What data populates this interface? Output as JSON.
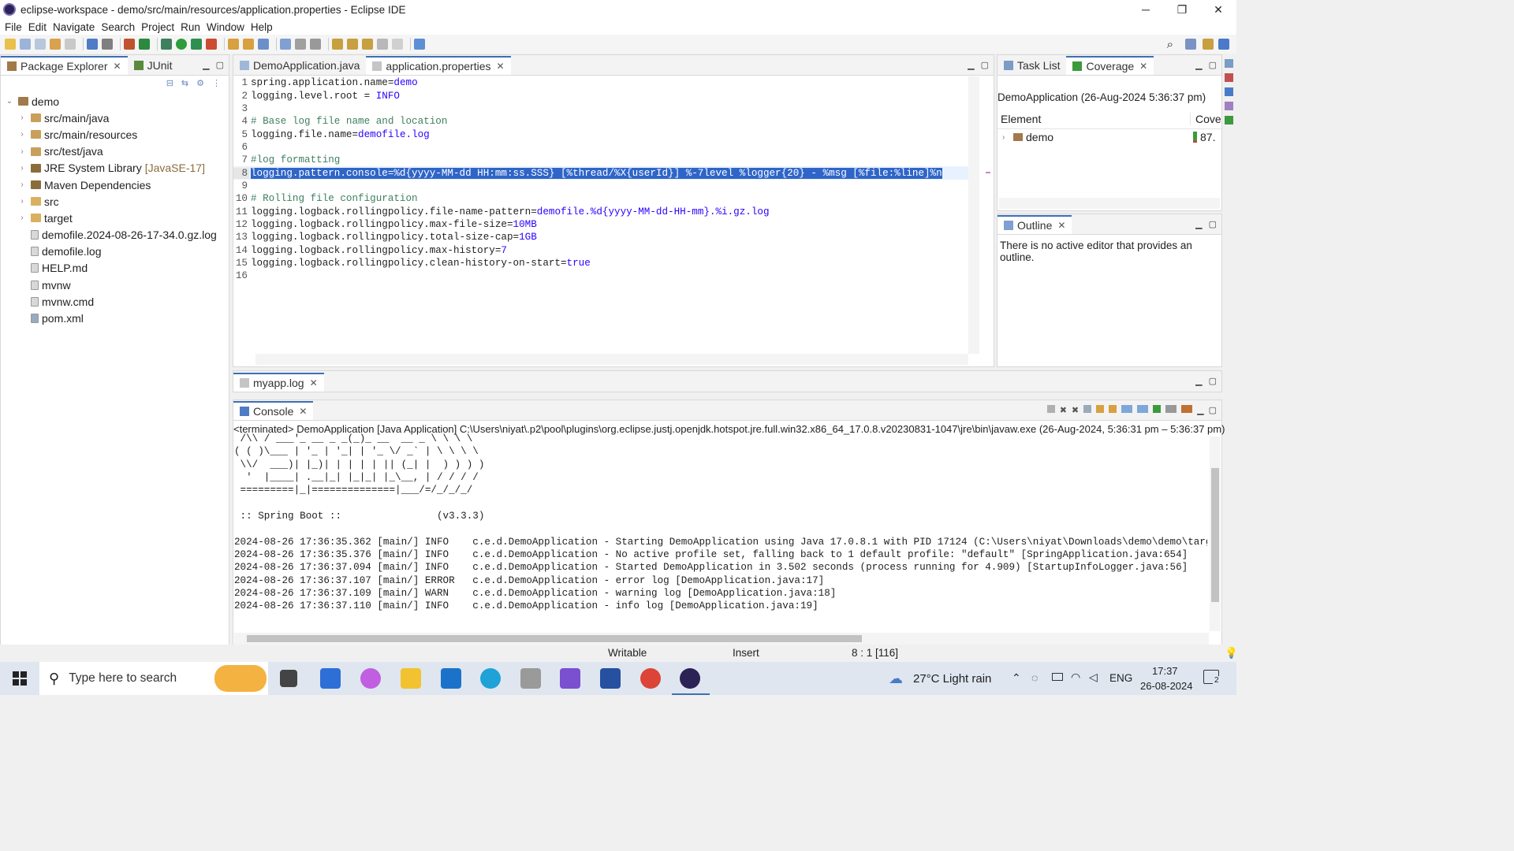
{
  "window": {
    "title": "eclipse-workspace - demo/src/main/resources/application.properties - Eclipse IDE",
    "minimize": "─",
    "restore": "❐",
    "close": "✕"
  },
  "menu": [
    "File",
    "Edit",
    "Navigate",
    "Search",
    "Project",
    "Run",
    "Window",
    "Help"
  ],
  "left_tabs": [
    {
      "label": "Package Explorer",
      "close": "✕"
    },
    {
      "label": "JUnit"
    }
  ],
  "tree": [
    {
      "label": "demo",
      "decor": "",
      "depth": 0,
      "expand": "⌄",
      "icon": "project"
    },
    {
      "label": "src/main/java",
      "decor": "",
      "depth": 1,
      "expand": "›",
      "icon": "package-folder"
    },
    {
      "label": "src/main/resources",
      "decor": "",
      "depth": 1,
      "expand": "›",
      "icon": "package-folder"
    },
    {
      "label": "src/test/java",
      "decor": "",
      "depth": 1,
      "expand": "›",
      "icon": "package-folder"
    },
    {
      "label": "JRE System Library",
      "decor": "[JavaSE-17]",
      "depth": 1,
      "expand": "›",
      "icon": "library"
    },
    {
      "label": "Maven Dependencies",
      "decor": "",
      "depth": 1,
      "expand": "›",
      "icon": "library"
    },
    {
      "label": "src",
      "decor": "",
      "depth": 1,
      "expand": "›",
      "icon": "folder"
    },
    {
      "label": "target",
      "decor": "",
      "depth": 1,
      "expand": "›",
      "icon": "folder"
    },
    {
      "label": "demofile.2024-08-26-17-34.0.gz.log",
      "decor": "",
      "depth": 1,
      "expand": "",
      "icon": "file"
    },
    {
      "label": "demofile.log",
      "decor": "",
      "depth": 1,
      "expand": "",
      "icon": "file"
    },
    {
      "label": "HELP.md",
      "decor": "",
      "depth": 1,
      "expand": "",
      "icon": "file"
    },
    {
      "label": "mvnw",
      "decor": "",
      "depth": 1,
      "expand": "",
      "icon": "file"
    },
    {
      "label": "mvnw.cmd",
      "decor": "",
      "depth": 1,
      "expand": "",
      "icon": "file"
    },
    {
      "label": "pom.xml",
      "decor": "",
      "depth": 1,
      "expand": "",
      "icon": "xml-file"
    }
  ],
  "editor_tabs": [
    {
      "label": "DemoApplication.java",
      "active": false
    },
    {
      "label": "application.properties",
      "active": true,
      "close": "✕"
    }
  ],
  "code_lines": [
    {
      "n": "1",
      "key": "spring.application.name=",
      "val": "demo",
      "cmt": ""
    },
    {
      "n": "2",
      "key": "logging.level.root = ",
      "val": "INFO",
      "cmt": ""
    },
    {
      "n": "3",
      "key": "",
      "val": "",
      "cmt": ""
    },
    {
      "n": "4",
      "key": "",
      "val": "",
      "cmt": "# Base log file name and location"
    },
    {
      "n": "5",
      "key": "logging.file.name=",
      "val": "demofile.log",
      "cmt": ""
    },
    {
      "n": "6",
      "key": "",
      "val": "",
      "cmt": ""
    },
    {
      "n": "7",
      "key": "",
      "val": "",
      "cmt": "#log formatting"
    },
    {
      "n": "8",
      "key": "",
      "val": "",
      "cmt": "",
      "selected": "logging.pattern.console=%d{yyyy-MM-dd HH:mm:ss.SSS} [%thread/%X{userId}] %-7level %logger{20} - %msg [%file:%line]%n"
    },
    {
      "n": "9",
      "key": "",
      "val": "",
      "cmt": ""
    },
    {
      "n": "10",
      "key": "",
      "val": "",
      "cmt": "# Rolling file configuration"
    },
    {
      "n": "11",
      "key": "logging.logback.rollingpolicy.file-name-pattern=",
      "val": "demofile.%d{yyyy-MM-dd-HH-mm}.%i.gz.log",
      "cmt": ""
    },
    {
      "n": "12",
      "key": "logging.logback.rollingpolicy.max-file-size=",
      "val": "10MB",
      "cmt": ""
    },
    {
      "n": "13",
      "key": "logging.logback.rollingpolicy.total-size-cap=",
      "val": "1GB",
      "cmt": ""
    },
    {
      "n": "14",
      "key": "logging.logback.rollingpolicy.max-history=",
      "val": "7",
      "cmt": ""
    },
    {
      "n": "15",
      "key": "logging.logback.rollingpolicy.clean-history-on-start=",
      "val": "true",
      "cmt": ""
    },
    {
      "n": "16",
      "key": "",
      "val": "",
      "cmt": ""
    }
  ],
  "right_top_tabs": [
    {
      "label": "Task List"
    },
    {
      "label": "Coverage",
      "close": "✕"
    }
  ],
  "coverage": {
    "session": "DemoApplication (26-Aug-2024 5:36:37 pm)",
    "col_element": "Element",
    "col_coverage": "Cove",
    "row_label": "demo",
    "row_value": "87."
  },
  "outline": {
    "label": "Outline",
    "close": "✕",
    "message": "There is no active editor that provides an outline."
  },
  "log_tab": {
    "label": "myapp.log",
    "close": "✕"
  },
  "console": {
    "label": "Console",
    "close": "✕",
    "header": "<terminated> DemoApplication [Java Application] C:\\Users\\niyat\\.p2\\pool\\plugins\\org.eclipse.justj.openjdk.hotspot.jre.full.win32.x86_64_17.0.8.v20230831-1047\\jre\\bin\\javaw.exe  (26-Aug-2024, 5:36:31 pm – 5:36:37 pm)",
    "lines": [
      " /\\\\ / ___'_ __ _ _(_)_ __  __ _ \\ \\ \\ \\",
      "( ( )\\___ | '_ | '_| | '_ \\/ _` | \\ \\ \\ \\",
      " \\\\/  ___)| |_)| | | | | || (_| |  ) ) ) )",
      "  '  |____| .__|_| |_|_| |_\\__, | / / / /",
      " =========|_|==============|___/=/_/_/_/",
      "",
      " :: Spring Boot ::                (v3.3.3)",
      "",
      "2024-08-26 17:36:35.362 [main/] INFO    c.e.d.DemoApplication - Starting DemoApplication using Java 17.0.8.1 with PID 17124 (C:\\Users\\niyat\\Downloads\\demo\\demo\\target\\c",
      "2024-08-26 17:36:35.376 [main/] INFO    c.e.d.DemoApplication - No active profile set, falling back to 1 default profile: \"default\" [SpringApplication.java:654]",
      "2024-08-26 17:36:37.094 [main/] INFO    c.e.d.DemoApplication - Started DemoApplication in 3.502 seconds (process running for 4.909) [StartupInfoLogger.java:56]",
      "2024-08-26 17:36:37.107 [main/] ERROR   c.e.d.DemoApplication - error log [DemoApplication.java:17]",
      "2024-08-26 17:36:37.109 [main/] WARN    c.e.d.DemoApplication - warning log [DemoApplication.java:18]",
      "2024-08-26 17:36:37.110 [main/] INFO    c.e.d.DemoApplication - info log [DemoApplication.java:19]"
    ]
  },
  "status": {
    "writable": "Writable",
    "mode": "Insert",
    "position": "8 : 1 [116]"
  },
  "taskbar": {
    "search_placeholder": "Type here to search",
    "weather": "27°C  Light rain",
    "lang": "ENG",
    "time": "17:37",
    "date": "26-08-2024",
    "notifications": "2"
  }
}
